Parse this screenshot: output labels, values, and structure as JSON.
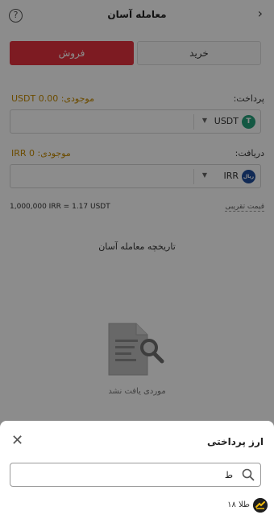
{
  "header": {
    "title": "معامله آسان",
    "back_icon": "chevron-right-icon",
    "help_icon": "help-circle-icon",
    "help_glyph": "?"
  },
  "tabs": {
    "sell": "فروش",
    "buy": "خرید"
  },
  "payment": {
    "label": "پرداخت:",
    "balance_caption": "موجودی:",
    "balance_value": "USDT 0.00",
    "currency": "USDT",
    "coin_glyph": "T",
    "value": ""
  },
  "receive": {
    "label": "دریافت:",
    "balance_caption": "موجودی:",
    "balance_value": "IRR 0",
    "currency": "IRR",
    "coin_glyph": "ریال",
    "value": ""
  },
  "rate": {
    "text": "1,000,000 IRR = 1.17 USDT",
    "link": "قیمت تقریبی"
  },
  "history": {
    "title": "تاریخچه معامله آسان",
    "empty_text": "موردی یافت نشد"
  },
  "sheet": {
    "title": "ارز پرداختی",
    "close_glyph": "✕",
    "search_value": "ط",
    "options": [
      {
        "label": "طلا ۱۸"
      }
    ]
  },
  "colors": {
    "sell": "#e4323f",
    "balance": "#c58a00",
    "usdt": "#26a17b",
    "irr": "#1f4e9c"
  }
}
